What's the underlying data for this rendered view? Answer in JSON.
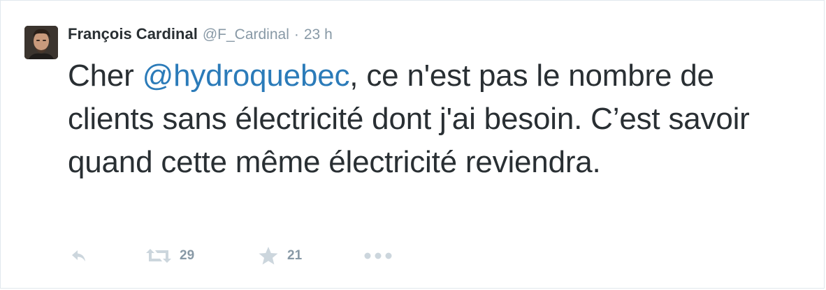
{
  "tweet": {
    "author": {
      "name": "François Cardinal",
      "handle": "@F_Cardinal"
    },
    "separator": "·",
    "time": "23 h",
    "text": {
      "before": "Cher ",
      "mention": "@hydroquebec",
      "after": ", ce n'est pas le nombre de clients sans électricité dont j'ai besoin. C’est savoir quand cette même électricité reviendra."
    },
    "actions": {
      "reply_icon": "reply-icon",
      "retweet_icon": "retweet-icon",
      "retweet_count": "29",
      "favorite_icon": "star-icon",
      "favorite_count": "21",
      "more_icon": "more-icon"
    }
  },
  "colors": {
    "name": "#292f33",
    "meta": "#8899a6",
    "mention": "#2b7bb9",
    "action_icon": "#ccd6dd",
    "border": "#e1e8ed"
  }
}
